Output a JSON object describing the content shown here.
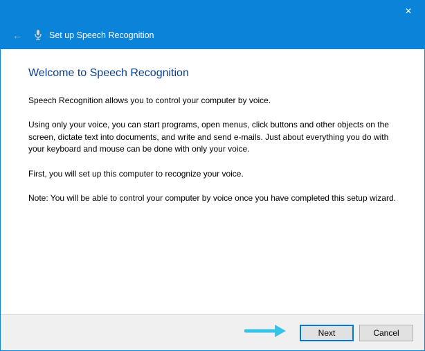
{
  "titlebar": {
    "close_label": "✕"
  },
  "header": {
    "back_glyph": "←",
    "title": "Set up Speech Recognition"
  },
  "content": {
    "heading": "Welcome to Speech Recognition",
    "p1": "Speech Recognition allows you to control your computer by voice.",
    "p2": "Using only your voice, you can start programs, open menus, click buttons and other objects on the screen, dictate text into documents, and write and send e-mails. Just about everything you do with your keyboard and mouse can be done with only your voice.",
    "p3": "First, you will set up this computer to recognize your voice.",
    "p4": "Note: You will be able to control your computer by voice once you have completed this setup wizard."
  },
  "footer": {
    "next_label": "Next",
    "cancel_label": "Cancel"
  }
}
